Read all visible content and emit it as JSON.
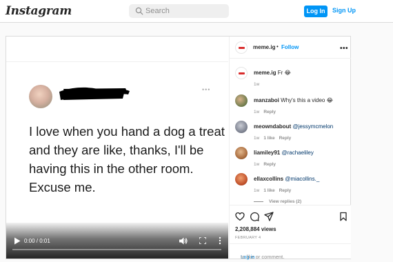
{
  "nav": {
    "logo": "Instagram",
    "search_placeholder": "Search",
    "login_label": "Log In",
    "signup_label": "Sign Up"
  },
  "video": {
    "caption": "I love when you hand a dog a treat and they are like, thanks, I'll be having this in the other room. Excuse me.",
    "time": "0:00 / 0:01",
    "progress": 0
  },
  "post": {
    "author": "meme.ig",
    "separator": "•",
    "follow_label": "Follow",
    "caption_text": "Fr 😂",
    "caption_age": "1w",
    "comments": [
      {
        "user": "manzaboi",
        "text": "Why's this a video 😂",
        "age": "1w",
        "likes": "",
        "reply": "Reply"
      },
      {
        "user": "meowndabout",
        "text": "@jessymcmelon",
        "age": "1w",
        "likes": "1 like",
        "reply": "Reply"
      },
      {
        "user": "liamiley91",
        "text": "@rachaeliley",
        "age": "1w",
        "likes": "",
        "reply": "Reply"
      },
      {
        "user": "ellaxcollins",
        "text": "@miacollins._",
        "age": "1w",
        "likes": "1 like",
        "reply": "Reply"
      }
    ],
    "view_replies": "View replies (2)",
    "views": "2,208,884 views",
    "date": "FEBRUARY 4",
    "login_link": "Log in",
    "login_suffix": " to like or comment."
  }
}
